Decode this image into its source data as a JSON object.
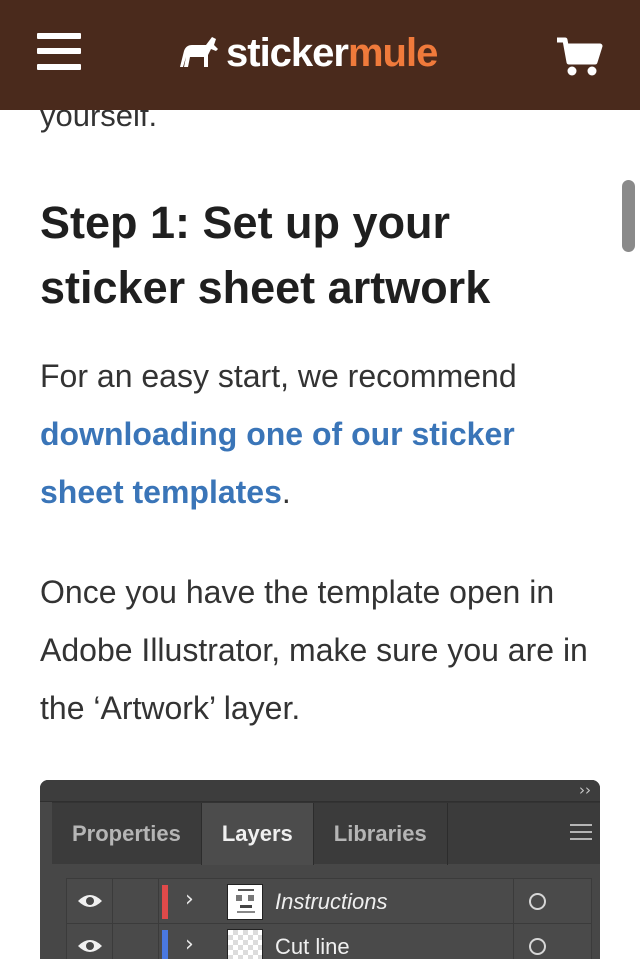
{
  "header": {
    "logo_part1": "sticker",
    "logo_part2": "mule",
    "brand_color": "#4a2a1c",
    "accent_color": "#f07a3b"
  },
  "article": {
    "previous_text_fragment": "yourself.",
    "step_title": "Step 1: Set up your sticker sheet artwork",
    "para1_text": "For an easy start, we recommend ",
    "para1_link": "downloading one of our sticker sheet templates",
    "para1_end": ".",
    "para2": "Once you have the template open in Adobe Illustrator, make sure you are in the ‘Artwork’ layer.",
    "link_color": "#3a75b8"
  },
  "illustrator_panel": {
    "collapse_glyph": "››",
    "tabs": [
      {
        "label": "Properties",
        "active": false
      },
      {
        "label": "Layers",
        "active": true
      },
      {
        "label": "Libraries",
        "active": false
      }
    ],
    "layers": [
      {
        "name": "Instructions",
        "color": "#e04a4a",
        "italic": true
      },
      {
        "name": "Cut line",
        "color": "#4a78e0",
        "italic": false
      }
    ]
  }
}
